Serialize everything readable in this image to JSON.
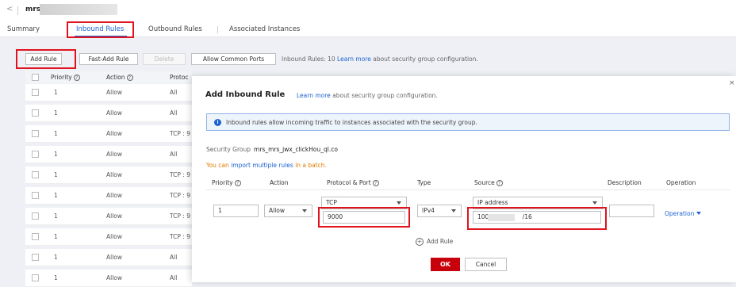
{
  "header": {
    "back_glyph": "<",
    "title": "mrs_"
  },
  "tabs": [
    "Summary",
    "Inbound Rules",
    "Outbound Rules",
    "Associated Instances"
  ],
  "toolbar": {
    "add_rule": "Add Rule",
    "fast_add_rule": "Fast-Add Rule",
    "delete": "Delete",
    "allow_common_ports": "Allow Common Ports",
    "info_prefix": "Inbound Rules: 10",
    "info_link": "Learn more",
    "info_suffix": "about security group configuration."
  },
  "table": {
    "columns": [
      "Priority",
      "Action",
      "Protoc"
    ],
    "rows": [
      {
        "priority": "1",
        "action": "Allow",
        "protocol": "All"
      },
      {
        "priority": "1",
        "action": "Allow",
        "protocol": "All"
      },
      {
        "priority": "1",
        "action": "Allow",
        "protocol": "TCP : 9"
      },
      {
        "priority": "1",
        "action": "Allow",
        "protocol": "All"
      },
      {
        "priority": "1",
        "action": "Allow",
        "protocol": "TCP : 9"
      },
      {
        "priority": "1",
        "action": "Allow",
        "protocol": "TCP : 9"
      },
      {
        "priority": "1",
        "action": "Allow",
        "protocol": "TCP : 9"
      },
      {
        "priority": "1",
        "action": "Allow",
        "protocol": "TCP : 9"
      },
      {
        "priority": "1",
        "action": "Allow",
        "protocol": "All"
      },
      {
        "priority": "1",
        "action": "Allow",
        "protocol": "All"
      }
    ]
  },
  "modal": {
    "close_glyph": "×",
    "title": "Add Inbound Rule",
    "title_link": "Learn more",
    "title_suffix": "about security group configuration.",
    "banner_text": "Inbound rules allow incoming traffic to instances associated with the security group.",
    "sg_label": "Security Group",
    "sg_value": "mrs_mrs_jwx_clickHou_ql.co",
    "import_prefix": "You can",
    "import_link": "import multiple rules",
    "import_suffix": "in a batch.",
    "columns": [
      "Priority",
      "Action",
      "Protocol & Port",
      "Type",
      "Source",
      "Description",
      "Operation"
    ],
    "rule": {
      "priority": "1",
      "action": "Allow",
      "protocol": "TCP",
      "port": "9000",
      "type": "IPv4",
      "source_type": "IP address",
      "source_prefix": "100.",
      "source_suffix": "/16",
      "description": "",
      "operation": "Operation"
    },
    "add_rule": "Add Rule",
    "ok": "OK",
    "cancel": "Cancel"
  },
  "colors": {
    "accent": "#1e63d0",
    "highlight": "#e0141e",
    "ok_button": "#c7000b",
    "note": "#e07b00"
  }
}
